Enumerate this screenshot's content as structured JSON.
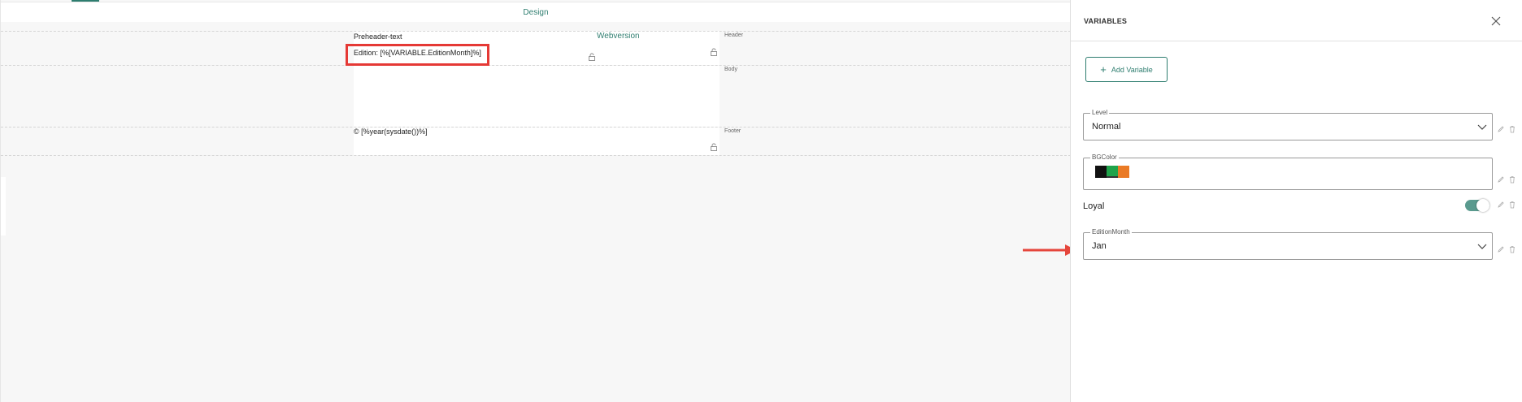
{
  "toolbar": {
    "design_label": "Design"
  },
  "email": {
    "preheader_text": "Preheader-text",
    "webversion_link": "Webversion",
    "edition_text": "Edition: [%[VARIABLE.EditionMonth]%]",
    "footer_text": "© [%year(sysdate())%]",
    "sections": {
      "header": "Header",
      "body": "Body",
      "footer": "Footer"
    }
  },
  "panel": {
    "title": "VARIABLES",
    "add_button_label": "Add Variable",
    "variables": {
      "level": {
        "label": "Level",
        "value": "Normal"
      },
      "bgcolor": {
        "label": "BGColor",
        "swatches": [
          "#111111",
          "#1fa34a",
          "#ea7a25"
        ]
      },
      "loyal": {
        "label": "Loyal",
        "enabled": true
      },
      "edition_month": {
        "label": "EditionMonth",
        "value": "Jan"
      }
    }
  },
  "colors": {
    "accent": "#2e7d6f",
    "highlight": "#e53935"
  }
}
